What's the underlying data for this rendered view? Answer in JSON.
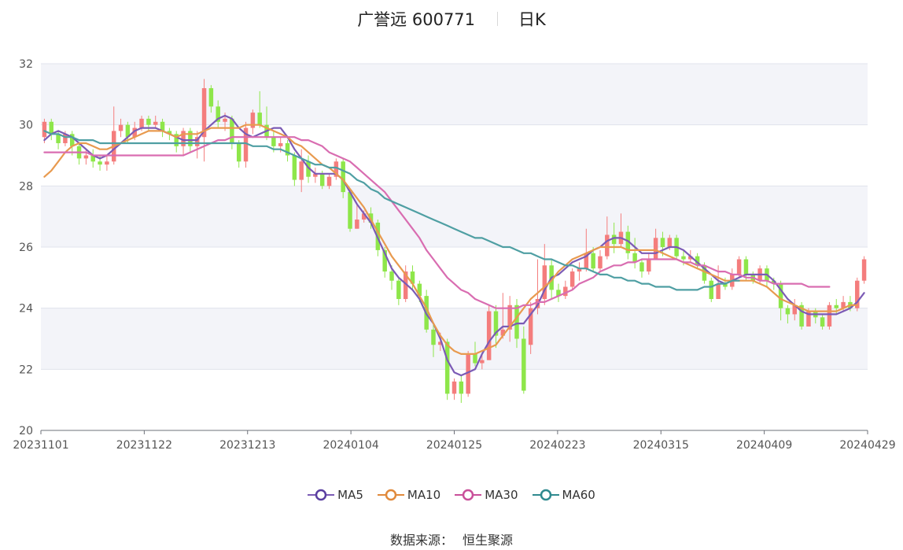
{
  "header": {
    "stock": "广誉远 600771",
    "period": "日K"
  },
  "source": {
    "label": "数据来源：",
    "provider": "恒生聚源"
  },
  "colors": {
    "up": "#f47d7d",
    "down": "#8ee64a",
    "ma5": "#7b5bb5",
    "ma10": "#e89a4f",
    "ma30": "#d96db1",
    "ma60": "#4f9fa3",
    "band": "#f3f4f9",
    "grid": "#e0e3ec"
  },
  "chart_data": {
    "type": "candlestick",
    "ylim": [
      20,
      32
    ],
    "yticks": [
      20,
      22,
      24,
      26,
      28,
      30,
      32
    ],
    "xtick_labels": [
      "20231101",
      "20231122",
      "20231213",
      "20240104",
      "20240125",
      "20240223",
      "20240315",
      "20240409",
      "20240429"
    ],
    "grid": true,
    "legend_position": "bottom",
    "candles": [
      [
        29.6,
        30.1,
        30.2,
        29.4
      ],
      [
        30.1,
        29.7,
        30.2,
        29.5
      ],
      [
        29.7,
        29.4,
        29.8,
        29.2
      ],
      [
        29.4,
        29.7,
        29.8,
        29.3
      ],
      [
        29.7,
        29.3,
        29.8,
        29.0
      ],
      [
        29.3,
        28.9,
        29.4,
        28.7
      ],
      [
        28.9,
        29.0,
        29.2,
        28.7
      ],
      [
        29.0,
        28.8,
        29.2,
        28.6
      ],
      [
        28.8,
        28.7,
        29.0,
        28.5
      ],
      [
        28.7,
        28.8,
        29.0,
        28.5
      ],
      [
        28.8,
        29.8,
        30.6,
        28.7
      ],
      [
        29.8,
        30.0,
        30.2,
        29.6
      ],
      [
        30.0,
        29.6,
        30.1,
        29.4
      ],
      [
        29.6,
        29.9,
        30.1,
        29.5
      ],
      [
        29.9,
        30.2,
        30.3,
        29.8
      ],
      [
        30.2,
        30.0,
        30.3,
        29.8
      ],
      [
        30.0,
        30.1,
        30.3,
        29.9
      ],
      [
        30.1,
        29.8,
        30.2,
        29.6
      ],
      [
        29.8,
        29.7,
        29.9,
        29.5
      ],
      [
        29.7,
        29.3,
        29.8,
        29.1
      ],
      [
        29.3,
        29.8,
        29.9,
        29.0
      ],
      [
        29.8,
        29.3,
        29.9,
        29.1
      ],
      [
        29.3,
        29.6,
        29.8,
        28.9
      ],
      [
        29.6,
        31.2,
        31.5,
        28.8
      ],
      [
        31.2,
        30.6,
        31.3,
        30.4
      ],
      [
        30.6,
        30.1,
        30.8,
        29.9
      ],
      [
        30.1,
        30.2,
        30.4,
        29.8
      ],
      [
        30.2,
        29.4,
        30.3,
        29.2
      ],
      [
        29.4,
        28.8,
        29.5,
        28.6
      ],
      [
        28.8,
        29.9,
        30.1,
        28.6
      ],
      [
        29.9,
        30.4,
        30.5,
        29.7
      ],
      [
        30.4,
        30.0,
        31.1,
        29.9
      ],
      [
        30.0,
        29.6,
        30.6,
        29.5
      ],
      [
        29.6,
        29.3,
        29.8,
        29.1
      ],
      [
        29.3,
        29.4,
        29.6,
        29.1
      ],
      [
        29.4,
        29.0,
        29.5,
        28.8
      ],
      [
        29.0,
        28.2,
        29.1,
        28.0
      ],
      [
        28.2,
        28.8,
        29.2,
        27.8
      ],
      [
        28.8,
        28.3,
        29.0,
        28.1
      ],
      [
        28.3,
        28.4,
        28.6,
        28.1
      ],
      [
        28.4,
        28.0,
        28.5,
        27.9
      ],
      [
        28.0,
        28.3,
        28.4,
        27.9
      ],
      [
        28.3,
        28.8,
        28.9,
        28.2
      ],
      [
        28.8,
        27.8,
        28.9,
        27.6
      ],
      [
        27.8,
        26.6,
        27.9,
        26.5
      ],
      [
        26.6,
        26.9,
        27.4,
        26.6
      ],
      [
        26.9,
        27.1,
        27.2,
        26.8
      ],
      [
        27.1,
        26.8,
        27.3,
        26.6
      ],
      [
        26.8,
        25.9,
        26.9,
        25.7
      ],
      [
        25.9,
        25.2,
        26.0,
        25.0
      ],
      [
        25.2,
        24.9,
        25.4,
        24.6
      ],
      [
        24.9,
        24.3,
        25.0,
        24.1
      ],
      [
        24.3,
        25.2,
        25.4,
        24.2
      ],
      [
        25.2,
        24.8,
        25.4,
        24.6
      ],
      [
        24.8,
        24.4,
        24.9,
        24.2
      ],
      [
        24.4,
        23.3,
        24.6,
        23.2
      ],
      [
        23.3,
        22.8,
        23.5,
        22.4
      ],
      [
        22.8,
        22.9,
        23.2,
        22.6
      ],
      [
        22.9,
        21.2,
        23.0,
        21.0
      ],
      [
        21.2,
        21.6,
        21.7,
        21.0
      ],
      [
        21.6,
        21.2,
        21.8,
        20.9
      ],
      [
        21.2,
        22.5,
        22.6,
        21.1
      ],
      [
        22.5,
        22.2,
        22.9,
        22.1
      ],
      [
        22.2,
        22.3,
        22.5,
        22.0
      ],
      [
        22.3,
        23.9,
        24.1,
        22.3
      ],
      [
        23.9,
        23.1,
        24.1,
        22.7
      ],
      [
        23.1,
        23.3,
        24.5,
        23.0
      ],
      [
        23.3,
        24.1,
        24.4,
        22.9
      ],
      [
        24.1,
        23.0,
        24.3,
        22.7
      ],
      [
        23.0,
        21.3,
        23.4,
        21.2
      ],
      [
        22.8,
        24.0,
        24.2,
        22.5
      ],
      [
        24.0,
        24.3,
        25.6,
        23.8
      ],
      [
        24.3,
        25.4,
        26.1,
        24.1
      ],
      [
        25.4,
        24.6,
        25.6,
        24.3
      ],
      [
        24.6,
        24.4,
        24.8,
        24.2
      ],
      [
        24.4,
        24.7,
        24.9,
        24.3
      ],
      [
        24.7,
        25.2,
        25.3,
        24.6
      ],
      [
        25.2,
        25.3,
        25.5,
        24.9
      ],
      [
        25.3,
        25.8,
        26.6,
        25.2
      ],
      [
        25.8,
        25.3,
        26.0,
        25.2
      ],
      [
        25.3,
        25.7,
        25.9,
        25.2
      ],
      [
        25.7,
        26.4,
        27.0,
        25.6
      ],
      [
        26.4,
        26.1,
        26.8,
        25.8
      ],
      [
        26.1,
        26.5,
        27.1,
        26.0
      ],
      [
        26.5,
        25.8,
        26.7,
        25.6
      ],
      [
        25.8,
        25.5,
        26.3,
        25.3
      ],
      [
        25.5,
        25.2,
        25.6,
        25.0
      ],
      [
        25.2,
        25.6,
        25.8,
        25.1
      ],
      [
        25.6,
        26.3,
        26.6,
        25.6
      ],
      [
        26.3,
        26.0,
        26.5,
        25.7
      ],
      [
        26.0,
        26.3,
        26.4,
        25.9
      ],
      [
        26.3,
        25.7,
        26.4,
        25.6
      ],
      [
        25.7,
        25.6,
        25.9,
        25.4
      ],
      [
        25.6,
        25.7,
        25.9,
        25.5
      ],
      [
        25.7,
        25.4,
        25.8,
        25.3
      ],
      [
        25.4,
        24.9,
        25.5,
        24.8
      ],
      [
        24.9,
        24.3,
        25.0,
        24.2
      ],
      [
        24.3,
        24.8,
        25.4,
        24.3
      ],
      [
        24.8,
        24.7,
        25.0,
        24.6
      ],
      [
        24.7,
        25.1,
        25.3,
        24.6
      ],
      [
        25.1,
        25.6,
        25.7,
        25.0
      ],
      [
        25.6,
        25.1,
        25.7,
        24.9
      ],
      [
        25.1,
        24.9,
        25.2,
        24.8
      ],
      [
        24.9,
        25.3,
        25.4,
        24.8
      ],
      [
        25.3,
        24.9,
        25.4,
        24.7
      ],
      [
        24.9,
        24.8,
        25.0,
        24.6
      ],
      [
        24.8,
        24.0,
        24.9,
        23.6
      ],
      [
        24.0,
        23.8,
        24.1,
        23.5
      ],
      [
        23.8,
        24.1,
        24.3,
        23.6
      ],
      [
        24.1,
        23.4,
        24.2,
        23.3
      ],
      [
        23.4,
        23.9,
        24.0,
        23.4
      ],
      [
        23.9,
        23.7,
        24.0,
        23.5
      ],
      [
        23.7,
        23.4,
        23.8,
        23.3
      ],
      [
        23.4,
        24.1,
        24.2,
        23.3
      ],
      [
        24.1,
        24.0,
        24.3,
        23.8
      ],
      [
        24.0,
        24.2,
        24.4,
        23.9
      ],
      [
        24.2,
        24.0,
        24.4,
        23.9
      ],
      [
        24.0,
        24.9,
        25.0,
        23.9
      ],
      [
        24.9,
        25.6,
        25.7,
        24.8
      ]
    ],
    "series": [
      {
        "name": "MA5",
        "values": [
          29.5,
          29.7,
          29.8,
          29.7,
          29.6,
          29.4,
          29.2,
          29.0,
          28.9,
          29.0,
          29.2,
          29.4,
          29.6,
          29.8,
          29.9,
          29.9,
          29.9,
          29.8,
          29.7,
          29.6,
          29.5,
          29.5,
          29.5,
          29.8,
          30.0,
          30.2,
          30.3,
          30.2,
          29.9,
          29.7,
          29.6,
          29.7,
          29.8,
          29.9,
          29.9,
          29.6,
          29.2,
          28.9,
          28.6,
          28.4,
          28.4,
          28.4,
          28.4,
          28.2,
          27.8,
          27.4,
          27.1,
          26.8,
          26.3,
          25.8,
          25.3,
          25.0,
          24.8,
          24.6,
          24.3,
          23.8,
          23.5,
          23.0,
          22.3,
          21.9,
          21.8,
          21.9,
          22.0,
          22.5,
          22.9,
          23.2,
          23.4,
          23.4,
          23.5,
          23.5,
          23.8,
          24.1,
          24.6,
          25.0,
          25.1,
          25.3,
          25.5,
          25.6,
          25.7,
          25.9,
          26.0,
          26.2,
          26.3,
          26.3,
          26.2,
          26.0,
          25.8,
          25.8,
          25.8,
          25.9,
          26.0,
          26.0,
          25.9,
          25.7,
          25.5,
          25.3,
          25.1,
          24.9,
          24.8,
          24.9,
          25.0,
          25.1,
          25.1,
          25.1,
          25.1,
          24.9,
          24.6,
          24.3,
          24.1,
          23.9,
          23.8,
          23.8,
          23.8,
          23.8,
          23.8,
          23.9,
          24.0,
          24.2,
          24.5
        ]
      },
      {
        "name": "MA10",
        "values": [
          28.3,
          28.5,
          28.8,
          29.1,
          29.3,
          29.4,
          29.4,
          29.3,
          29.2,
          29.2,
          29.3,
          29.4,
          29.5,
          29.6,
          29.7,
          29.8,
          29.8,
          29.8,
          29.7,
          29.6,
          29.7,
          29.7,
          29.7,
          29.8,
          29.9,
          29.9,
          29.9,
          29.9,
          29.9,
          30.0,
          30.0,
          30.0,
          29.9,
          29.8,
          29.7,
          29.6,
          29.4,
          29.3,
          29.1,
          28.9,
          28.7,
          28.6,
          28.4,
          28.2,
          27.9,
          27.6,
          27.3,
          26.9,
          26.5,
          26.1,
          25.7,
          25.4,
          25.1,
          24.8,
          24.4,
          24.0,
          23.5,
          23.1,
          22.8,
          22.6,
          22.5,
          22.5,
          22.5,
          22.6,
          22.7,
          22.8,
          23.1,
          23.4,
          23.7,
          24.0,
          24.3,
          24.5,
          24.7,
          24.9,
          25.2,
          25.4,
          25.6,
          25.7,
          25.8,
          25.9,
          26.0,
          26.0,
          26.0,
          26.0,
          25.9,
          25.9,
          25.9,
          25.9,
          25.9,
          25.8,
          25.7,
          25.6,
          25.5,
          25.4,
          25.3,
          25.2,
          25.1,
          25.0,
          24.9,
          24.9,
          24.9,
          24.9,
          24.9,
          24.8,
          24.7,
          24.5,
          24.3,
          24.2,
          24.1,
          24.0,
          23.9,
          23.9,
          23.9,
          23.9,
          23.9,
          24.0,
          24.1,
          24.1
        ]
      },
      {
        "name": "MA30",
        "values": [
          29.1,
          29.1,
          29.1,
          29.1,
          29.1,
          29.1,
          29.1,
          29.0,
          29.0,
          29.0,
          29.0,
          29.0,
          29.0,
          29.0,
          29.0,
          29.0,
          29.0,
          29.0,
          29.0,
          29.0,
          29.0,
          29.1,
          29.2,
          29.3,
          29.4,
          29.5,
          29.5,
          29.6,
          29.6,
          29.6,
          29.6,
          29.6,
          29.6,
          29.6,
          29.6,
          29.6,
          29.6,
          29.5,
          29.5,
          29.4,
          29.3,
          29.1,
          29.0,
          28.9,
          28.8,
          28.6,
          28.4,
          28.2,
          28.0,
          27.8,
          27.5,
          27.2,
          26.9,
          26.6,
          26.3,
          25.9,
          25.6,
          25.3,
          25.0,
          24.8,
          24.6,
          24.5,
          24.3,
          24.2,
          24.1,
          24.0,
          24.0,
          24.0,
          24.0,
          24.1,
          24.1,
          24.2,
          24.2,
          24.3,
          24.4,
          24.5,
          24.6,
          24.8,
          24.9,
          25.0,
          25.2,
          25.3,
          25.4,
          25.4,
          25.5,
          25.5,
          25.6,
          25.6,
          25.6,
          25.6,
          25.6,
          25.6,
          25.5,
          25.5,
          25.4,
          25.4,
          25.3,
          25.2,
          25.2,
          25.1,
          25.1,
          25.0,
          25.0,
          24.9,
          24.9,
          24.8,
          24.8,
          24.8,
          24.8,
          24.8,
          24.7,
          24.7,
          24.7,
          24.7
        ]
      },
      {
        "name": "MA60",
        "values": [
          29.8,
          29.7,
          29.7,
          29.6,
          29.6,
          29.5,
          29.5,
          29.5,
          29.4,
          29.4,
          29.4,
          29.4,
          29.4,
          29.4,
          29.4,
          29.4,
          29.4,
          29.4,
          29.4,
          29.4,
          29.4,
          29.4,
          29.4,
          29.4,
          29.4,
          29.4,
          29.4,
          29.4,
          29.4,
          29.4,
          29.3,
          29.3,
          29.3,
          29.2,
          29.2,
          29.1,
          29.0,
          28.9,
          28.8,
          28.7,
          28.7,
          28.6,
          28.6,
          28.5,
          28.4,
          28.2,
          28.1,
          27.9,
          27.8,
          27.6,
          27.5,
          27.4,
          27.3,
          27.2,
          27.1,
          27.0,
          26.9,
          26.8,
          26.7,
          26.6,
          26.5,
          26.4,
          26.3,
          26.3,
          26.2,
          26.1,
          26.0,
          26.0,
          25.9,
          25.8,
          25.8,
          25.7,
          25.6,
          25.6,
          25.5,
          25.4,
          25.4,
          25.3,
          25.3,
          25.2,
          25.1,
          25.1,
          25.0,
          25.0,
          24.9,
          24.9,
          24.8,
          24.8,
          24.7,
          24.7,
          24.7,
          24.6,
          24.6,
          24.6,
          24.6,
          24.7,
          24.7,
          24.8,
          24.8,
          24.9,
          24.9
        ]
      }
    ]
  }
}
